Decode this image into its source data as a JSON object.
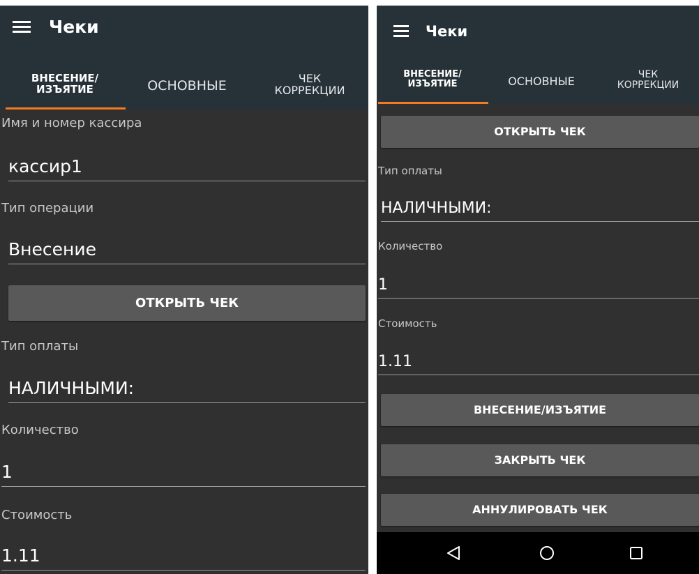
{
  "left": {
    "app_title": "Чеки",
    "tabs": [
      {
        "line1": "ВНЕСЕНИЕ/",
        "line2": "ИЗЪЯТИЕ"
      },
      {
        "line1": "ОСНОВНЫЕ",
        "line2": ""
      },
      {
        "line1": "ЧЕК",
        "line2": "КОРРЕКЦИИ"
      }
    ],
    "cashier_label": "Имя и номер кассира",
    "cashier_value": "кассир1",
    "operation_label": "Тип операции",
    "operation_value": "Внесение",
    "open_receipt_button": "ОТКРЫТЬ ЧЕК",
    "payment_label": "Тип оплаты",
    "payment_value": "НАЛИЧНЫМИ:",
    "quantity_label": "Количество",
    "quantity_value": "1",
    "cost_label": "Стоимость",
    "cost_value": "1.11"
  },
  "right": {
    "app_title": "Чеки",
    "tabs": [
      {
        "line1": "ВНЕСЕНИЕ/",
        "line2": "ИЗЪЯТИЕ"
      },
      {
        "line1": "ОСНОВНЫЕ",
        "line2": ""
      },
      {
        "line1": "ЧЕК",
        "line2": "КОРРЕКЦИИ"
      }
    ],
    "open_receipt_button": "ОТКРЫТЬ ЧЕК",
    "payment_label": "Тип оплаты",
    "payment_value": "НАЛИЧНЫМИ:",
    "quantity_label": "Количество",
    "quantity_value": "1",
    "cost_label": "Стоимость",
    "cost_value": "1.11",
    "deposit_withdraw_button": "ВНЕСЕНИЕ/ИЗЪЯТИЕ",
    "close_receipt_button": "ЗАКРЫТЬ ЧЕК",
    "cancel_receipt_button": "АННУЛИРОВАТЬ ЧЕК"
  },
  "icons": {
    "menu": "hamburger-icon",
    "nav_back": "triangle-back-icon",
    "nav_home": "circle-home-icon",
    "nav_recents": "square-recents-icon"
  },
  "colors": {
    "app_bar": "#263238",
    "background": "#303030",
    "tab_indicator": "#f47b20",
    "button": "#595959",
    "nav_bar": "#000000"
  }
}
